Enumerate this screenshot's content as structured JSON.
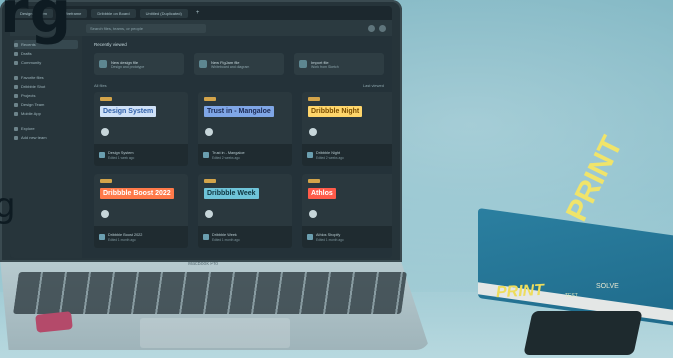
{
  "overlay": {
    "top_text": "rg",
    "side_text": "g"
  },
  "laptop": {
    "brand": "MacBook Pro"
  },
  "tabs": [
    "Design System",
    "Wireframe",
    "Dribbble on Board",
    "Untitled (Duplicated)"
  ],
  "toolbar": {
    "search_placeholder": "Search files, teams, or people"
  },
  "sidebar": {
    "items": [
      {
        "label": "Recents",
        "active": true
      },
      {
        "label": "Drafts"
      },
      {
        "label": "Community"
      },
      {
        "label": "Favorite files"
      },
      {
        "label": "Dribbble Shot"
      },
      {
        "label": "Projects"
      },
      {
        "label": "Design Team"
      },
      {
        "label": "Mobile App"
      },
      {
        "label": "Explore"
      },
      {
        "label": "Add new team"
      }
    ]
  },
  "main": {
    "title": "Recently viewed",
    "actions": [
      {
        "title": "New design file",
        "sub": "Design and prototype"
      },
      {
        "title": "New FigJam file",
        "sub": "Whiteboard and diagram"
      },
      {
        "title": "Import file",
        "sub": "Work from Sketch"
      }
    ],
    "filter_left": "All files",
    "filter_right": "Last viewed"
  },
  "files": [
    {
      "thumb": "Design System",
      "thumb_bg": "#cfe1f7",
      "thumb_fg": "#2f5fa8",
      "name": "Design System",
      "sub": "Edited 1 week ago"
    },
    {
      "thumb": "Trust in - Mangaloe",
      "thumb_bg": "#7fa6e6",
      "thumb_fg": "#1c2a55",
      "name": "Trust in - Mangaloe",
      "sub": "Edited 2 weeks ago"
    },
    {
      "thumb": "Dribbble Night",
      "thumb_bg": "#ffd66b",
      "thumb_fg": "#7a4d00",
      "name": "Dribbble Night",
      "sub": "Edited 2 weeks ago"
    },
    {
      "thumb": "Dribbble Boost 2022",
      "thumb_bg": "#ff7a4a",
      "thumb_fg": "#ffffff",
      "name": "Dribbble Boost 2022",
      "sub": "Edited 1 month ago"
    },
    {
      "thumb": "Dribbble Week",
      "thumb_bg": "#6fc4d9",
      "thumb_fg": "#0e3540",
      "name": "Dribbble Week",
      "sub": "Edited 1 month ago"
    },
    {
      "thumb": "Athlos",
      "thumb_bg": "#ff5b4a",
      "thumb_fg": "#ffffff",
      "name": "Athlos Shopify",
      "sub": "Edited 1 month ago"
    }
  ],
  "book": {
    "title_top": "PRINT",
    "spine": "PRINT",
    "spine_small": "TEST",
    "spine_right": "SOLVE"
  }
}
